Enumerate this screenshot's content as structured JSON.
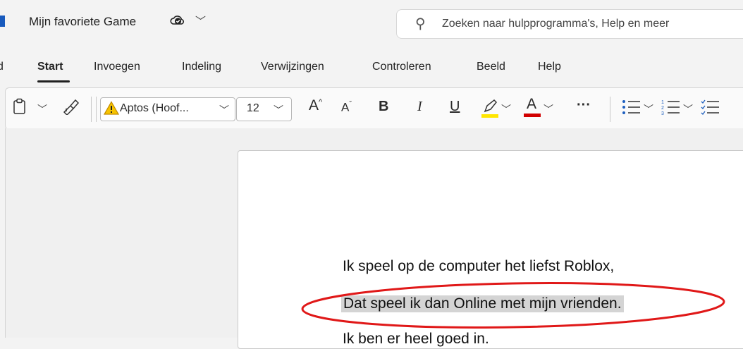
{
  "titlebar": {
    "doc_title": "Mijn favoriete Game",
    "cloud_icon": "cloud-sync-icon",
    "search_placeholder": "Zoeken naar hulpprogramma's, Help en meer"
  },
  "tabs": [
    {
      "label": "d"
    },
    {
      "label": "Start",
      "active": true
    },
    {
      "label": "Invoegen"
    },
    {
      "label": "Indeling"
    },
    {
      "label": "Verwijzingen"
    },
    {
      "label": "Controleren"
    },
    {
      "label": "Beeld"
    },
    {
      "label": "Help"
    }
  ],
  "toolbar": {
    "font_name": "Aptos (Hoof...",
    "font_size": "12",
    "grow_font": "A",
    "shrink_font": "A",
    "bold": "B",
    "italic": "I",
    "underline": "U",
    "font_color_glyph": "A",
    "more": "···",
    "highlight_color": "#ffe600",
    "font_color": "#d10000",
    "warning_color": "#e0a000"
  },
  "document": {
    "lines": [
      "Ik speel op de computer het liefst Roblox,",
      "Dat speel ik dan Online met mijn vrienden.",
      "Ik ben er heel goed in."
    ],
    "selected_line_index": 1
  },
  "annotation": {
    "shape": "ellipse",
    "color": "#e01818"
  }
}
